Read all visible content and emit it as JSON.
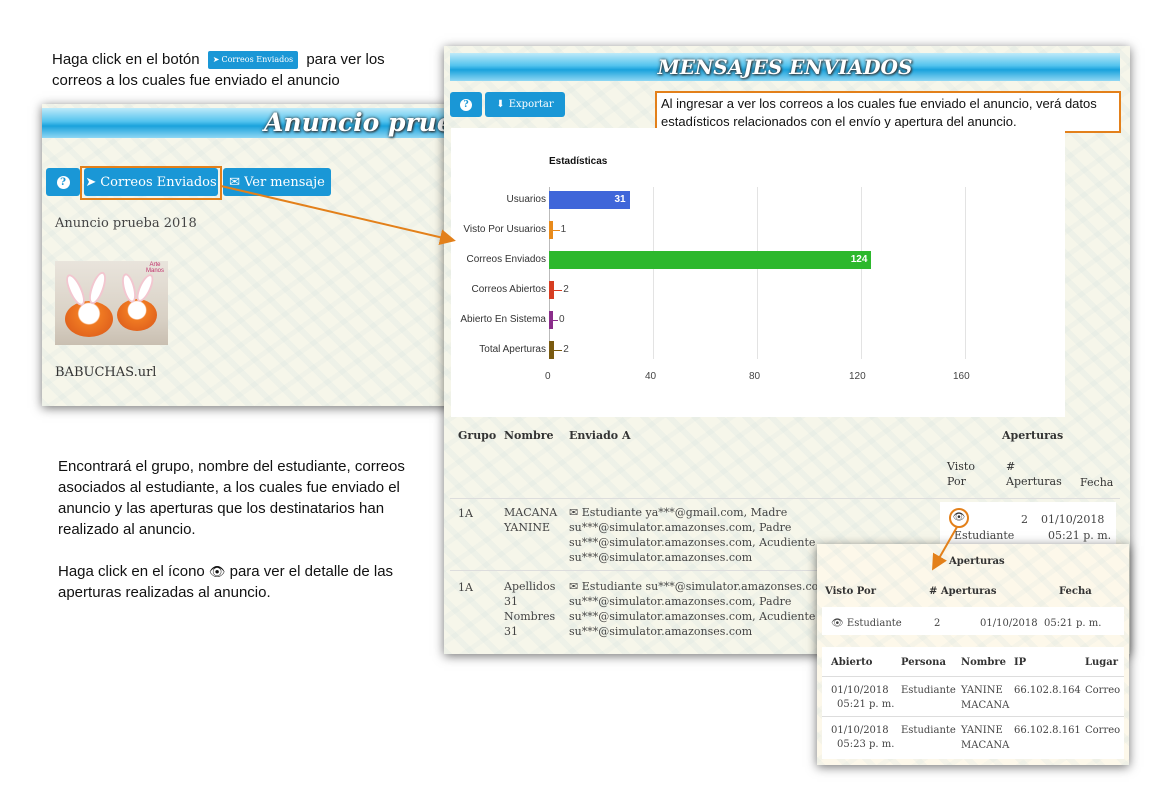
{
  "instructions": {
    "line1_pre": "Haga click en el botón",
    "inline_button": "Correos Enviados",
    "line1_post": "para  ver  los",
    "line2": "correos a los cuales fue enviado el anuncio",
    "para2": "Encontrará el grupo, nombre del estudiante, correos asociados al estudiante, a los cuales fue enviado el anuncio y las aperturas que los destinatarios han realizado al anuncio.",
    "para3_pre": "Haga click en el ícono",
    "para3_post": "para ver el detalle de las aperturas realizadas al anuncio."
  },
  "announcement": {
    "title": "Anuncio prueba",
    "buttons": {
      "help": "?",
      "sent": "Correos Enviados",
      "view": "Ver mensaje"
    },
    "name": "Anuncio prueba 2018",
    "image_brand": "Arte Manos",
    "attachment": "BABUCHAS.url"
  },
  "sent_panel": {
    "title": "MENSAJES ENVIADOS",
    "buttons": {
      "help": "?",
      "export": "Exportar"
    },
    "callout": "Al ingresar a ver los correos a los cuales fue enviado el anuncio, verá datos estadísticos relacionados con el envío y apertura del anuncio.",
    "table": {
      "headers": {
        "group": "Grupo",
        "name": "Nombre",
        "sent_to": "Enviado A",
        "openings": "Aperturas",
        "seen_by": "Visto Por",
        "count": "# Aperturas",
        "date": "Fecha"
      },
      "rows": [
        {
          "group": "1A",
          "name": "MACANA YANINE",
          "sent_to": "Estudiante ya***@gmail.com, Madre su***@simulator.amazonses.com, Padre su***@simulator.amazonses.com, Acudiente su***@simulator.amazonses.com",
          "seen_by": "Estudiante",
          "count": "2",
          "date": "01/10/2018",
          "time": "05:21 p. m."
        },
        {
          "group": "1A",
          "name": "Apellidos 31 Nombres 31",
          "sent_to": "Estudiante su***@simulator.amazonses.com, Madre su***@simulator.amazonses.com, Padre su***@simulator.amazonses.com, Acudiente su***@simulator.amazonses.com"
        }
      ]
    }
  },
  "chart_data": {
    "type": "bar",
    "orientation": "horizontal",
    "title": "Estadísticas",
    "categories": [
      "Usuarios",
      "Visto Por Usuarios",
      "Correos Enviados",
      "Correos Abiertos",
      "Abierto En Sistema",
      "Total Aperturas"
    ],
    "values": [
      31,
      1,
      124,
      2,
      0,
      2
    ],
    "colors": [
      "#3f66d9",
      "#e88a1b",
      "#2db82d",
      "#d63d22",
      "#8a2d8a",
      "#7a5a10"
    ],
    "xlim": [
      0,
      160
    ],
    "xticks": [
      "0",
      "40",
      "80",
      "120",
      "160"
    ],
    "grid": true
  },
  "detail_popup": {
    "title": "Aperturas",
    "headers": {
      "seen_by": "Visto Por",
      "count": "# Aperturas",
      "date": "Fecha"
    },
    "summary": {
      "seen_by": "Estudiante",
      "count": "2",
      "date": "01/10/2018  05:21 p. m."
    },
    "detail_headers": {
      "opened": "Abierto",
      "person": "Persona",
      "name": "Nombre",
      "ip": "IP",
      "place": "Lugar"
    },
    "detail_rows": [
      {
        "opened": "01/10/2018",
        "opened_time": "05:21 p. m.",
        "person": "Estudiante",
        "name": "YANINE MACANA",
        "ip": "66.102.8.164",
        "place": "Correo"
      },
      {
        "opened": "01/10/2018",
        "opened_time": "05:23 p. m.",
        "person": "Estudiante",
        "name": "YANINE MACANA",
        "ip": "66.102.8.161",
        "place": "Correo"
      }
    ]
  }
}
